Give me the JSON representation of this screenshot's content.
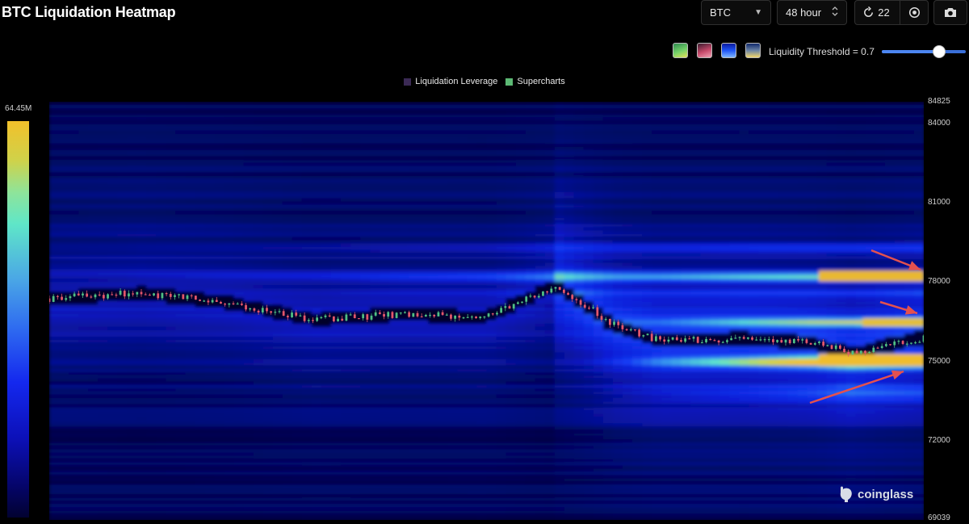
{
  "header": {
    "title": "BTC Liquidation Heatmap",
    "symbol_select": {
      "value": "BTC",
      "icon": "caret-down-icon"
    },
    "range_select": {
      "value": "48 hour",
      "icon": "up-down-chevron-icon"
    },
    "refresh": {
      "count": "22",
      "icon": "refresh-icon"
    },
    "record_icon": "record-icon",
    "camera_icon": "camera-icon"
  },
  "palette_swatches": [
    "green-yellow",
    "red-pink",
    "blue",
    "blue-yellow"
  ],
  "threshold": {
    "label": "Liquidity Threshold = 0.7",
    "value": 0.7
  },
  "legend": [
    {
      "label": "Liquidation Leverage",
      "color": "#3b2a55"
    },
    {
      "label": "Supercharts",
      "color": "#5cb974"
    }
  ],
  "colorbar": {
    "max_label": "64.45M"
  },
  "y_axis": {
    "min": 69039,
    "max": 84825,
    "ticks": [
      "84825",
      "84000",
      "81000",
      "78000",
      "75000",
      "72000",
      "69039"
    ]
  },
  "watermark": "coinglass",
  "colors": {
    "bg": "#000000",
    "heat_low": "#01001f",
    "heat_mid": "#0a23e6",
    "heat_cyan": "#5fe6c8",
    "heat_high": "#f2c02a",
    "candle_up": "#4fbf84",
    "candle_down": "#e3566c",
    "arrow": "#e4514f"
  },
  "chart_data": {
    "type": "heatmap",
    "title": "BTC Liquidation Heatmap",
    "ylim": [
      69039,
      84825
    ],
    "price_series_approx": [
      {
        "t": 0.0,
        "price": 77400
      },
      {
        "t": 0.1,
        "price": 77600
      },
      {
        "t": 0.2,
        "price": 77250
      },
      {
        "t": 0.3,
        "price": 76600
      },
      {
        "t": 0.4,
        "price": 76800
      },
      {
        "t": 0.5,
        "price": 76700
      },
      {
        "t": 0.58,
        "price": 77900
      },
      {
        "t": 0.65,
        "price": 76300
      },
      {
        "t": 0.7,
        "price": 75800
      },
      {
        "t": 0.8,
        "price": 75900
      },
      {
        "t": 0.88,
        "price": 75700
      },
      {
        "t": 0.92,
        "price": 75300
      },
      {
        "t": 1.0,
        "price": 75900
      }
    ],
    "liquidity_bands": [
      {
        "price": 78250,
        "intensity": "high"
      },
      {
        "price": 76500,
        "intensity": "high"
      },
      {
        "price": 75000,
        "intensity": "high"
      }
    ]
  }
}
